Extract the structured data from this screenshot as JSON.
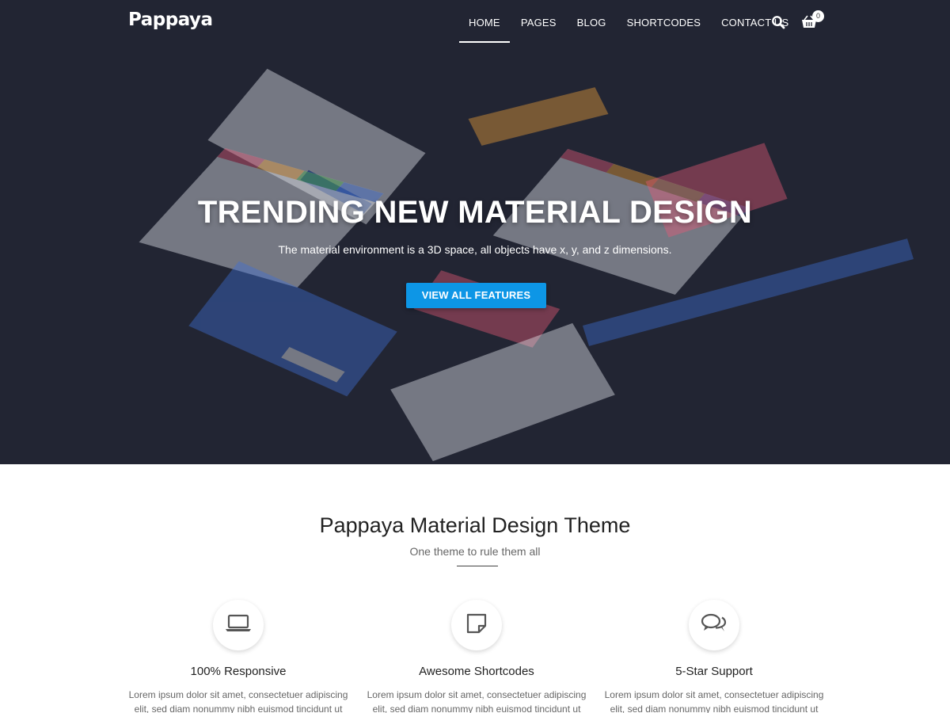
{
  "brand": {
    "logo": "Pappaya"
  },
  "nav": {
    "items": [
      {
        "label": "HOME",
        "active": true
      },
      {
        "label": "PAGES"
      },
      {
        "label": "BLOG"
      },
      {
        "label": "SHORTCODES"
      },
      {
        "label": "CONTACT US"
      }
    ],
    "search_icon": "search-icon",
    "cart_icon": "shopping-basket-icon",
    "cart_count": "0"
  },
  "hero": {
    "title": "TRENDING NEW MATERIAL DESIGN",
    "subtitle": "The material environment is a 3D space, all objects have x, y, and z dimensions.",
    "button_label": "VIEW ALL FEATURES",
    "background_color": "#222533",
    "button_color": "#0d96e6"
  },
  "intro": {
    "title": "Pappaya Material Design Theme",
    "subtitle": "One theme to rule them all"
  },
  "features": [
    {
      "icon": "laptop-icon",
      "title": "100% Responsive",
      "text": "Lorem ipsum dolor sit amet, consectetuer adipiscing elit, sed diam nonummy nibh euismod tincidunt ut"
    },
    {
      "icon": "sticky-note-icon",
      "title": "Awesome Shortcodes",
      "text": "Lorem ipsum dolor sit amet, consectetuer adipiscing elit, sed diam nonummy nibh euismod tincidunt ut"
    },
    {
      "icon": "chat-bubbles-icon",
      "title": "5-Star Support",
      "text": "Lorem ipsum dolor sit amet, consectetuer adipiscing elit, sed diam nonummy nibh euismod tincidunt ut"
    }
  ]
}
